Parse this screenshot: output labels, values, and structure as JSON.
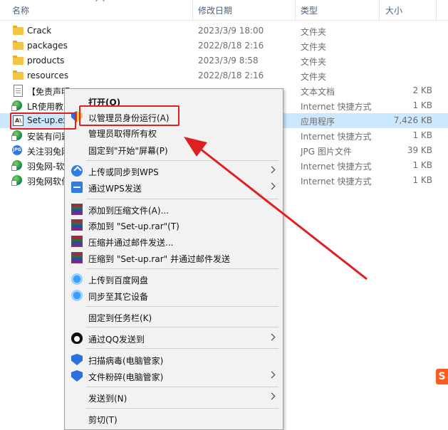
{
  "header": {
    "name": "名称",
    "date": "修改日期",
    "type": "类型",
    "size": "大小"
  },
  "files": [
    {
      "icon": "folder-icon",
      "name": "Crack",
      "date": "2023/3/9 18:00",
      "type": "文件夹",
      "size": ""
    },
    {
      "icon": "folder-icon",
      "name": "packages",
      "date": "2022/8/18 2:16",
      "type": "文件夹",
      "size": ""
    },
    {
      "icon": "folder-icon",
      "name": "products",
      "date": "2023/3/9 8:58",
      "type": "文件夹",
      "size": ""
    },
    {
      "icon": "folder-icon",
      "name": "resources",
      "date": "2022/8/18 2:16",
      "type": "文件夹",
      "size": ""
    },
    {
      "icon": "text-document-icon",
      "name": "【免责声明",
      "date": "",
      "type": "文本文档",
      "size": "2 KB"
    },
    {
      "icon": "internet-shortcut-icon",
      "name": "LR使用教",
      "date": "",
      "type": "Internet 快捷方式",
      "size": "1 KB"
    },
    {
      "icon": "exe-icon",
      "name": "Set-up.ex",
      "date": "",
      "type": "应用程序",
      "size": "7,426 KB"
    },
    {
      "icon": "internet-shortcut-icon",
      "name": "安装有问题",
      "date": "",
      "type": "Internet 快捷方式",
      "size": "1 KB"
    },
    {
      "icon": "jpg-icon",
      "name": "关注羽兔网",
      "date": "",
      "type": "JPG 图片文件",
      "size": "39 KB"
    },
    {
      "icon": "internet-shortcut-icon",
      "name": "羽兔网-软",
      "date": "",
      "type": "Internet 快捷方式",
      "size": "1 KB"
    },
    {
      "icon": "internet-shortcut-icon",
      "name": "羽兔网软件",
      "date": "",
      "type": "Internet 快捷方式",
      "size": "1 KB"
    }
  ],
  "menu": {
    "open": "打开(O)",
    "run_as_admin": "以管理员身份运行(A)",
    "take_ownership": "管理员取得所有权",
    "pin_start": "固定到\"开始\"屏幕(P)",
    "wps_upload": "上传或同步到WPS",
    "wps_send": "通过WPS发送",
    "rar_add": "添加到压缩文件(A)...",
    "rar_add_named": "添加到 \"Set-up.rar\"(T)",
    "rar_email": "压缩并通过邮件发送...",
    "rar_named_email": "压缩到 \"Set-up.rar\" 并通过邮件发送",
    "baidu_upload": "上传到百度网盘",
    "baidu_sync": "同步至其它设备",
    "pin_taskbar": "固定到任务栏(K)",
    "qq_send": "通过QQ发送到",
    "scan_virus": "扫描病毒(电脑管家)",
    "shred": "文件粉碎(电脑管家)",
    "send_to": "发送到(N)",
    "cut": "剪切(T)"
  },
  "colors": {
    "annotation": "#e02020",
    "selection": "#cce8ff"
  },
  "corner_logo": "S"
}
